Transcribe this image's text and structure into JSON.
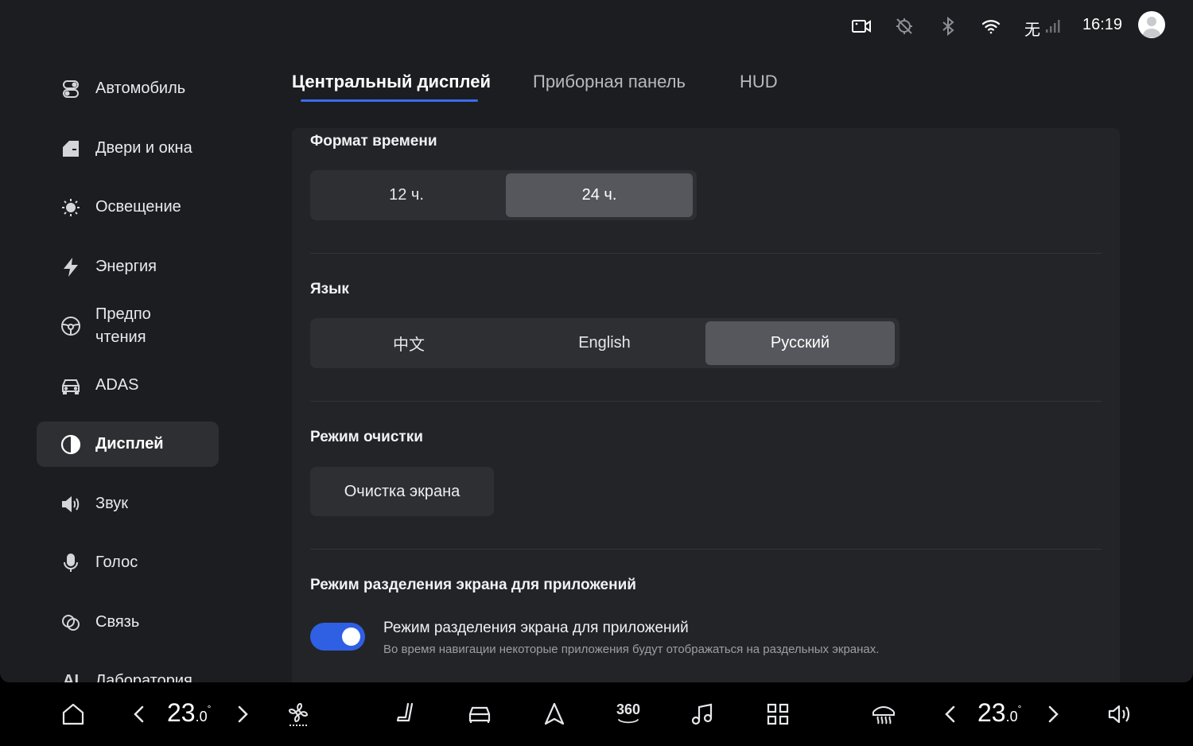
{
  "status_bar": {
    "network_label": "无",
    "time": "16:19",
    "icons": [
      "camera-icon",
      "location-off-icon",
      "bluetooth-icon",
      "wifi-icon",
      "signal-icon",
      "avatar"
    ]
  },
  "sidebar": {
    "items": [
      {
        "label": "Автомобиль",
        "icon": "car-toggle-icon"
      },
      {
        "label": "Двери и окна",
        "icon": "door-icon"
      },
      {
        "label": "Освещение",
        "icon": "light-icon"
      },
      {
        "label": "Энергия",
        "icon": "lightning-icon"
      },
      {
        "label": "Предпо\nчтения",
        "icon": "steering-wheel-icon"
      },
      {
        "label": "ADAS",
        "icon": "car-front-icon"
      },
      {
        "label": "Дисплей",
        "icon": "display-contrast-icon",
        "active": true
      },
      {
        "label": "Звук",
        "icon": "speaker-icon"
      },
      {
        "label": "Голос",
        "icon": "microphone-icon"
      },
      {
        "label": "Связь",
        "icon": "link-icon"
      },
      {
        "label": "Лаборатория",
        "icon": "ai-icon"
      }
    ]
  },
  "tabs": [
    {
      "label": "Центральный дисплей",
      "active": true
    },
    {
      "label": "Приборная панель"
    },
    {
      "label": "HUD"
    }
  ],
  "sections": {
    "time_format": {
      "title": "Формат времени",
      "options": [
        "12 ч.",
        "24 ч."
      ],
      "selected": "24 ч."
    },
    "language": {
      "title": "Язык",
      "options": [
        "中文",
        "English",
        "Русский"
      ],
      "selected": "Русский"
    },
    "clean_mode": {
      "title": "Режим очистки",
      "button_label": "Очистка экрана"
    },
    "split_screen": {
      "title": "Режим разделения экрана для приложений",
      "toggle_label": "Режим разделения экрана для приложений",
      "toggle_description": "Во время навигации некоторые приложения будут отображаться на раздельных экранах.",
      "enabled": true
    }
  },
  "dock": {
    "left_temp_whole": "23",
    "left_temp_decimal": ".0",
    "right_temp_whole": "23",
    "right_temp_decimal": ".0",
    "degree": "°",
    "icons": [
      "home-icon",
      "fan-icon",
      "seat-icon",
      "car-icon",
      "navigation-icon",
      "360-camera-icon",
      "music-icon",
      "apps-grid-icon",
      "rear-defrost-icon",
      "volume-icon"
    ],
    "label_360": "360"
  },
  "colors": {
    "accent": "#3a6cf0",
    "toggle_on": "#2f5fe3",
    "background": "#1c1d20",
    "panel": "#232427"
  }
}
